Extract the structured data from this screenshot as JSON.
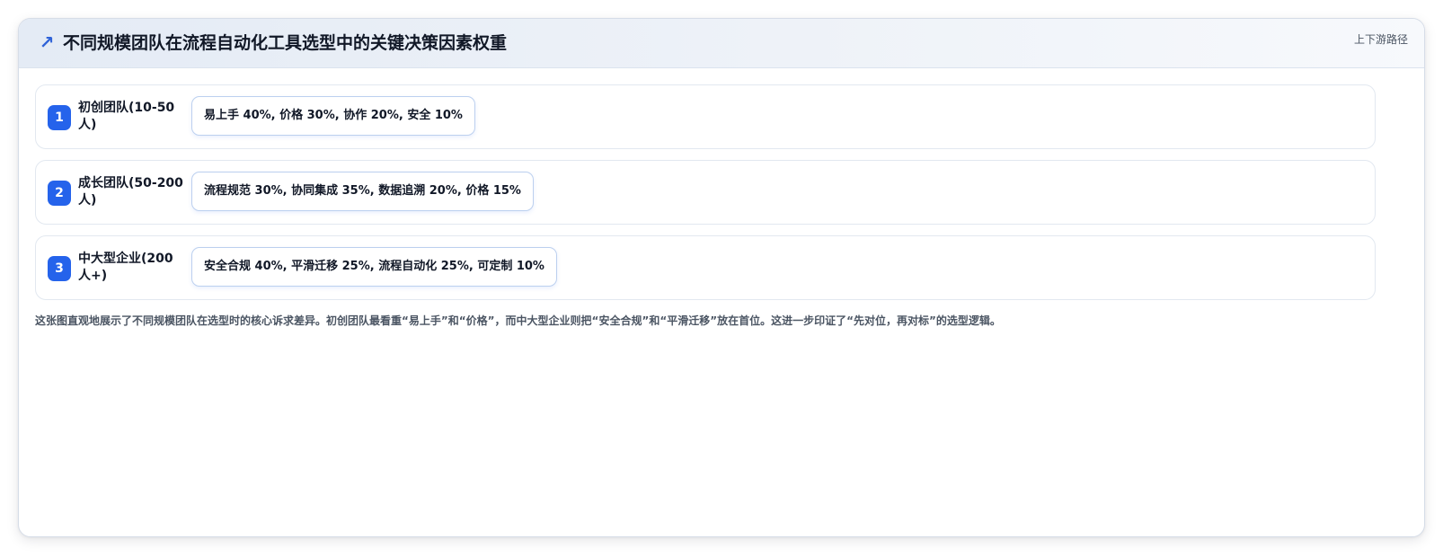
{
  "header": {
    "icon": "trend-arrow-icon",
    "title": "不同规模团队在流程自动化工具选型中的关键决策因素权重",
    "link_label": "上下游路径"
  },
  "rows": [
    {
      "number": "1",
      "label": "初创团队(10-50人)",
      "factors": "易上手 40%, 价格 30%, 协作 20%, 安全 10%"
    },
    {
      "number": "2",
      "label": "成长团队(50-200人)",
      "factors": "流程规范 30%, 协同集成 35%, 数据追溯 20%, 价格 15%"
    },
    {
      "number": "3",
      "label": "中大型企业(200人+)",
      "factors": "安全合规 40%, 平滑迁移 25%, 流程自动化 25%, 可定制 10%"
    }
  ],
  "caption": "这张图直观地展示了不同规模团队在选型时的核心诉求差异。初创团队最看重“易上手”和“价格”，而中大型企业则把“安全合规”和“平滑迁移”放在首位。这进一步印证了“先对位，再对标”的选型逻辑。",
  "colors": {
    "accent": "#2563eb",
    "title": "#111827",
    "muted": "#4b5563",
    "border": "#e2e8f0"
  }
}
